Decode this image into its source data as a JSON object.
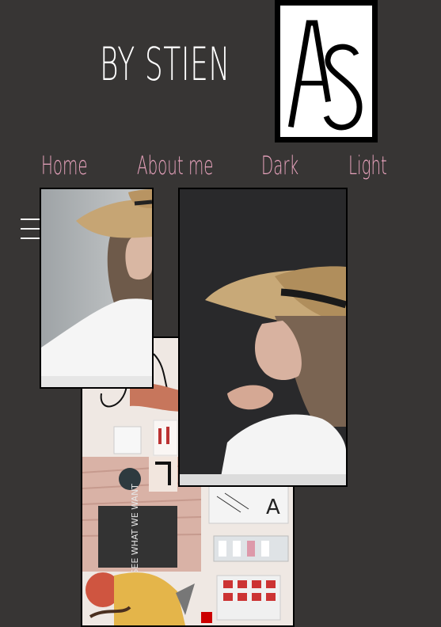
{
  "header": {
    "brand_name": "BY STIEN",
    "logo_text": "AS"
  },
  "nav": {
    "items": [
      {
        "label": "Home"
      },
      {
        "label": "About me"
      },
      {
        "label": "Dark"
      },
      {
        "label": "Light"
      }
    ]
  },
  "menu": {
    "icon": "hamburger-menu-icon"
  },
  "moodboard": {
    "panel_text": "WE SEE WHAT WE WANT",
    "letter": "A"
  },
  "colors": {
    "background": "#373534",
    "nav_link": "#e8a3bd",
    "brand": "#ffffff"
  }
}
